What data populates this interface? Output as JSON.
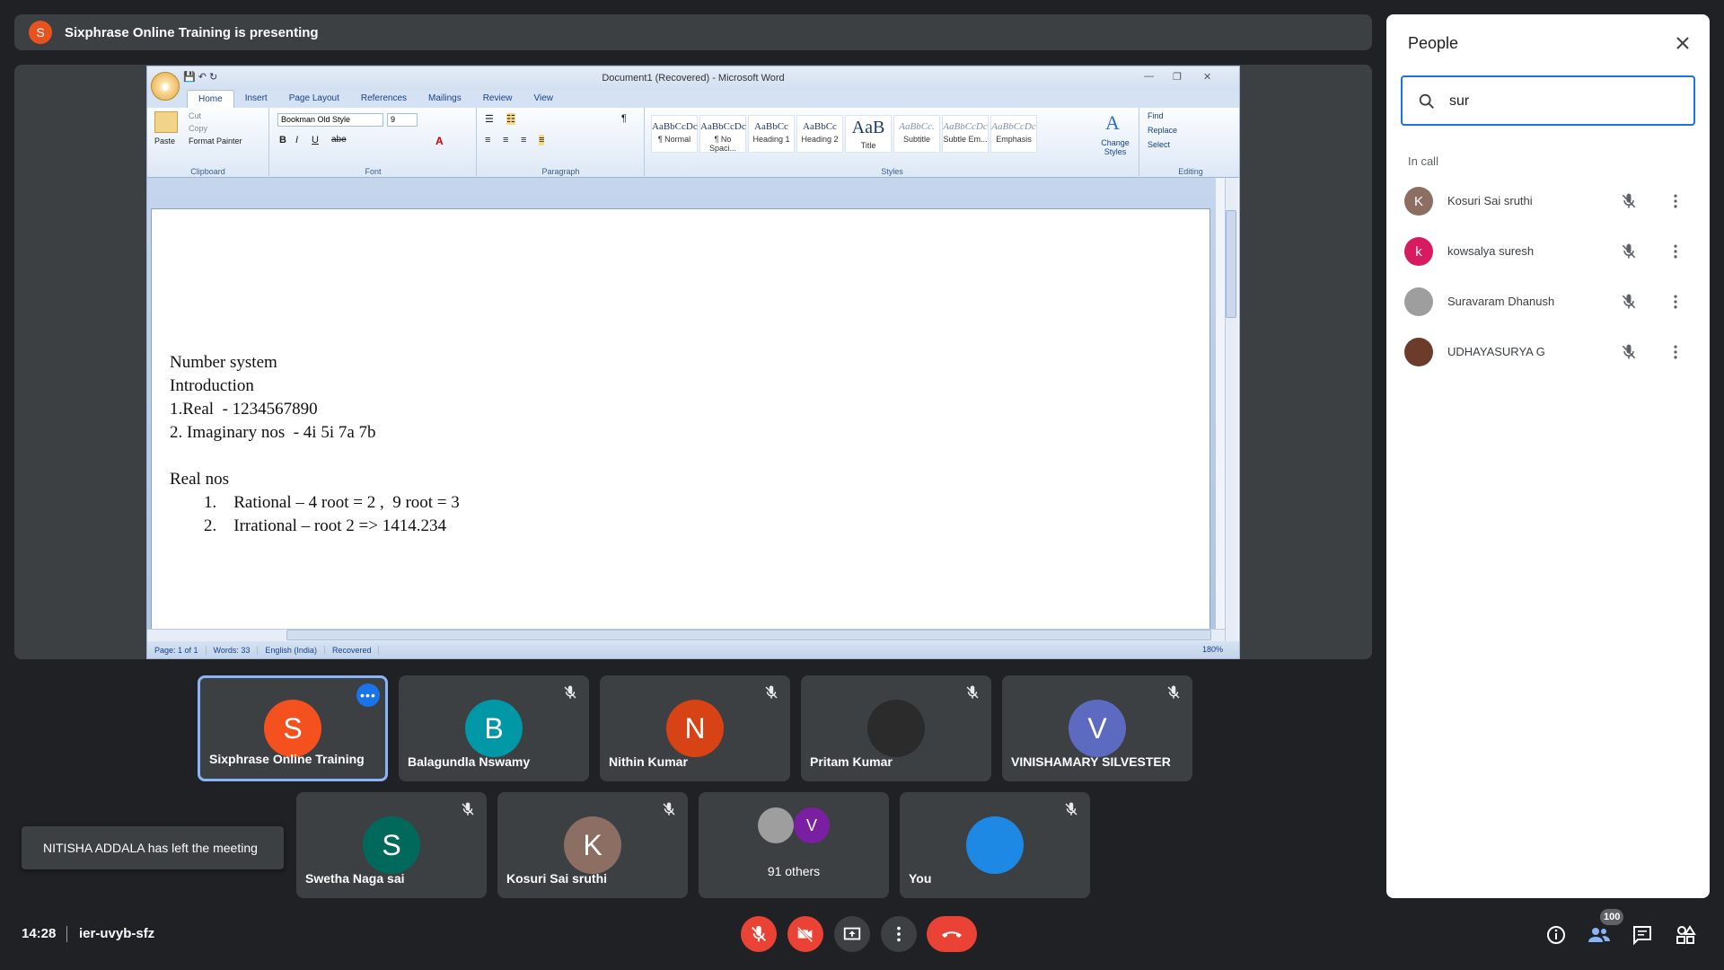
{
  "banner": {
    "avatar_letter": "S",
    "text": "Sixphrase Online Training is presenting"
  },
  "word": {
    "title": "Document1 (Recovered) - Microsoft Word",
    "tabs": [
      "Home",
      "Insert",
      "Page Layout",
      "References",
      "Mailings",
      "Review",
      "View"
    ],
    "clipboard": {
      "paste": "Paste",
      "cut": "Cut",
      "copy": "Copy",
      "format_painter": "Format Painter",
      "label": "Clipboard"
    },
    "font": {
      "name": "Bookman Old Style",
      "size": "9",
      "label": "Font"
    },
    "paragraph_label": "Paragraph",
    "styles": [
      {
        "sample": "AaBbCcDc",
        "name": "¶ Normal"
      },
      {
        "sample": "AaBbCcDc",
        "name": "¶ No Spaci..."
      },
      {
        "sample": "AaBbCc",
        "name": "Heading 1"
      },
      {
        "sample": "AaBbCc",
        "name": "Heading 2"
      },
      {
        "sample": "AaB",
        "name": "Title"
      },
      {
        "sample": "AaBbCc.",
        "name": "Subtitle"
      },
      {
        "sample": "AaBbCcDc",
        "name": "Subtle Em..."
      },
      {
        "sample": "AaBbCcDc",
        "name": "Emphasis"
      }
    ],
    "change_styles": "Change Styles",
    "styles_label": "Styles",
    "editing": {
      "find": "Find",
      "replace": "Replace",
      "select": "Select",
      "label": "Editing"
    },
    "document_lines": [
      "Number system",
      "Introduction",
      "1.Real  - 1234567890",
      "2. Imaginary nos  - 4i 5i 7a 7b",
      "",
      "Real nos"
    ],
    "list_items": [
      "1.    Rational – 4 root = 2 ,  9 root = 3",
      "2.    Irrational – root 2 => 1414.234"
    ],
    "status": {
      "page": "Page: 1 of 1",
      "words": "Words: 33",
      "language": "English (India)",
      "recovered": "Recovered",
      "zoom": "180%"
    }
  },
  "tiles": [
    {
      "letter": "S",
      "name": "Sixphrase Online Training",
      "color": "#f4511e",
      "pinned": true
    },
    {
      "letter": "B",
      "name": "Balagundla Nswamy",
      "color": "#0097a7"
    },
    {
      "letter": "N",
      "name": "Nithin Kumar",
      "color": "#d84315"
    },
    {
      "letter": "",
      "name": "Pritam Kumar",
      "color": "#2b2b2b"
    },
    {
      "letter": "V",
      "name": "VINISHAMARY SILVESTER",
      "color": "#5c6bc0"
    },
    {
      "letter": "S",
      "name": "Swetha Naga sai",
      "color": "#00695c"
    },
    {
      "letter": "K",
      "name": "Kosuri Sai sruthi",
      "color": "#8d6e63"
    },
    {
      "letter": "V",
      "name": "91 others",
      "color": "#7b1fa2"
    },
    {
      "letter": "",
      "name": "You",
      "color": "#1e88e5"
    }
  ],
  "toast": "NITISHA ADDALA has left the meeting",
  "bottom": {
    "time": "14:28",
    "meeting_code": "ier-uvyb-sfz",
    "people_count": "100"
  },
  "people": {
    "title": "People",
    "search_value": "sur",
    "section": "In call",
    "list": [
      {
        "letter": "K",
        "name": "Kosuri Sai sruthi",
        "color": "#8d6e63"
      },
      {
        "letter": "k",
        "name": "kowsalya suresh",
        "color": "#d81b60"
      },
      {
        "letter": "",
        "name": "Suravaram Dhanush",
        "color": "#9e9e9e"
      },
      {
        "letter": "",
        "name": "UDHAYASURYA G",
        "color": "#6d3b2a"
      }
    ]
  }
}
